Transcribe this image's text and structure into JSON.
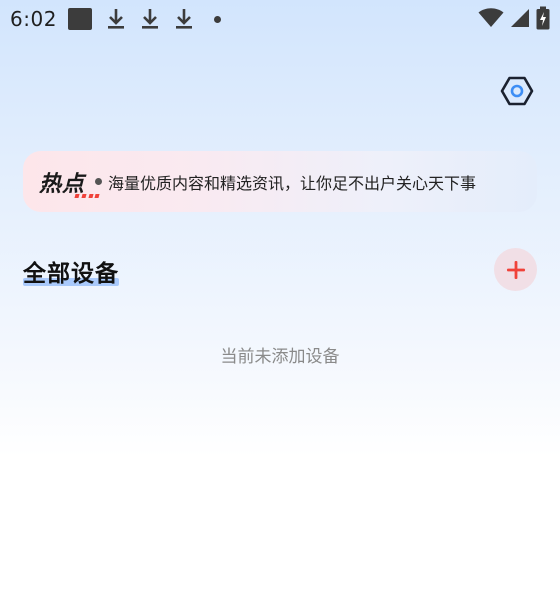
{
  "status_bar": {
    "time": "6:02",
    "left_icons": [
      "notification-square-icon",
      "download-icon",
      "download-icon",
      "download-icon",
      "more-dot-icon"
    ],
    "right_icons": [
      "wifi-icon",
      "cellular-signal-icon",
      "battery-icon"
    ]
  },
  "banner": {
    "logo_text": "热点",
    "text": "海量优质内容和精选资讯，让你足不出户关心天下事"
  },
  "section": {
    "title": "全部设备"
  },
  "empty_state": {
    "text": "当前未添加设备"
  },
  "colors": {
    "accent_red": "#f0423a",
    "title_highlight": "#a9c9fb",
    "settings_ring": "#3d8ef5"
  }
}
